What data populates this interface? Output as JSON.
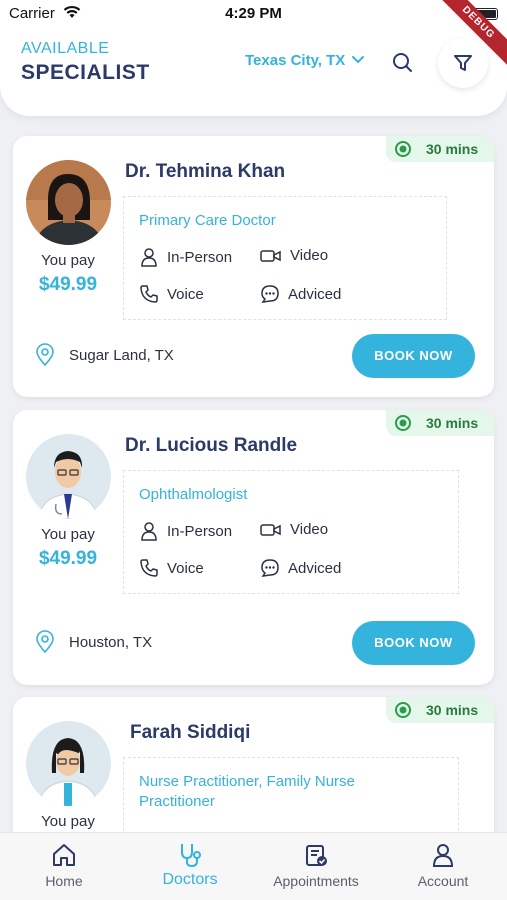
{
  "status_bar": {
    "carrier": "Carrier",
    "time": "4:29 PM"
  },
  "debug_ribbon": "DEBUG",
  "header": {
    "title_line1": "AVAILABLE",
    "title_line2": "SPECIALIST",
    "location": "Texas City, TX"
  },
  "doctors": [
    {
      "name": "Dr. Tehmina Khan",
      "specialty": "Primary Care Doctor",
      "you_pay_label": "You pay",
      "price": "$49.99",
      "duration": "30 mins",
      "modes": [
        "In-Person",
        "Video",
        "Voice",
        "Adviced"
      ],
      "location": "Sugar Land, TX",
      "book_label": "BOOK NOW"
    },
    {
      "name": "Dr. Lucious Randle",
      "specialty": "Ophthalmologist",
      "you_pay_label": "You pay",
      "price": "$49.99",
      "duration": "30 mins",
      "modes": [
        "In-Person",
        "Video",
        "Voice",
        "Adviced"
      ],
      "location": "Houston, TX",
      "book_label": "BOOK NOW"
    },
    {
      "name": "Farah Siddiqi",
      "specialty_line1": "Nurse Practitioner, Family Nurse",
      "specialty_line2": "Practitioner",
      "you_pay_label": "You pay",
      "duration": "30 mins"
    }
  ],
  "bottom_nav": {
    "items": [
      {
        "label": "Home",
        "icon": "home-icon"
      },
      {
        "label": "Doctors",
        "icon": "stethoscope-icon"
      },
      {
        "label": "Appointments",
        "icon": "appointments-icon"
      },
      {
        "label": "Account",
        "icon": "account-icon"
      }
    ],
    "active": "Doctors"
  },
  "colors": {
    "accent": "#34b3dd",
    "title": "#2b3a67",
    "duration_bg": "#e4f7ea",
    "duration_text": "#2a7a3f"
  }
}
